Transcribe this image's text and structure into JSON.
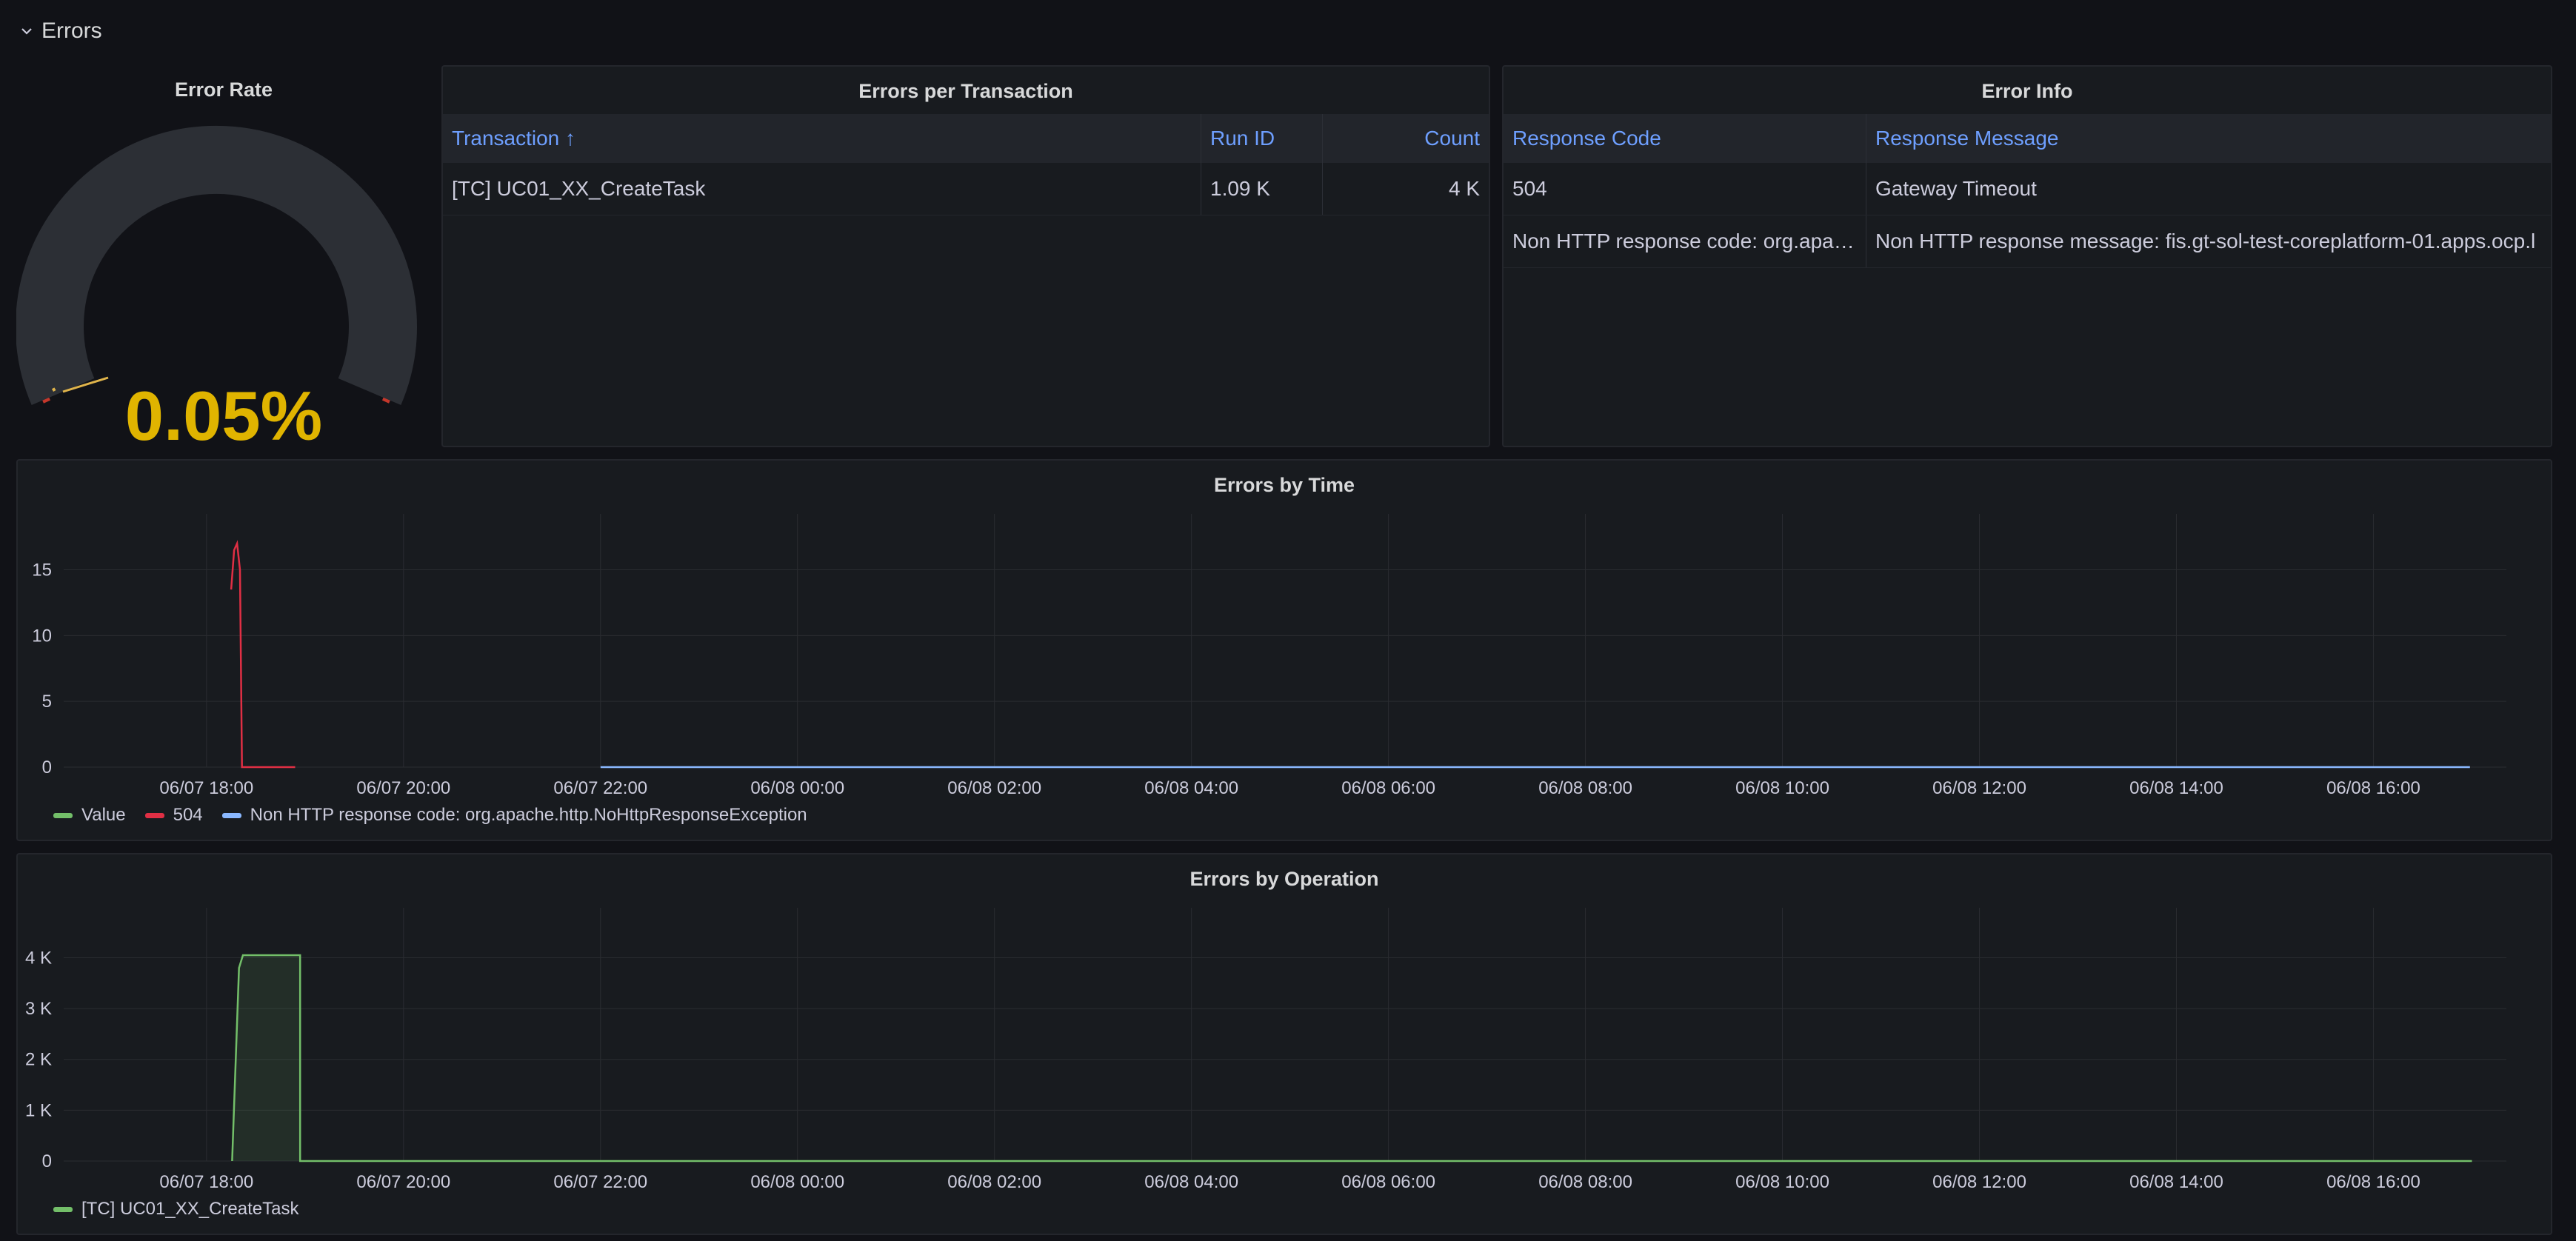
{
  "row": {
    "title": "Errors"
  },
  "gauge": {
    "title": "Error Rate",
    "value": "0.05%",
    "fraction": 0.0005,
    "color_value": "#e0b44b",
    "color_threshold": "#c4372b"
  },
  "txn_table": {
    "title": "Errors per Transaction",
    "columns": [
      "Transaction ↑",
      "Run ID",
      "Count"
    ],
    "rows": [
      [
        "[TC] UC01_XX_CreateTask",
        "1.09 K",
        "4 K"
      ]
    ]
  },
  "info_table": {
    "title": "Error Info",
    "columns": [
      "Response Code",
      "Response Message"
    ],
    "rows": [
      [
        "504",
        "Gateway Timeout"
      ],
      [
        "Non HTTP response code: org.apache.http.NoHttpResponseException",
        "Non HTTP response message: fis.gt-sol-test-coreplatform-01.apps.ocp.l"
      ]
    ]
  },
  "chart_data": [
    {
      "type": "line",
      "title": "Errors by Time",
      "x_ticks": [
        "06/07 18:00",
        "06/07 20:00",
        "06/07 22:00",
        "06/08 00:00",
        "06/08 02:00",
        "06/08 04:00",
        "06/08 06:00",
        "06/08 08:00",
        "06/08 10:00",
        "06/08 12:00",
        "06/08 14:00",
        "06/08 16:00"
      ],
      "y_ticks": [
        "0",
        "5",
        "10",
        "15"
      ],
      "ylim": [
        0,
        17
      ],
      "xlim_hours": [
        16.55,
        41.35
      ],
      "series": [
        {
          "name": "Value",
          "color": "#73bf69",
          "points": []
        },
        {
          "name": "504",
          "color": "#e02f44",
          "points": [
            [
              18.25,
              13.5
            ],
            [
              18.28,
              16.5
            ],
            [
              18.31,
              17
            ],
            [
              18.34,
              15
            ],
            [
              18.36,
              0
            ],
            [
              18.9,
              0
            ]
          ]
        },
        {
          "name": "Non HTTP response code: org.apache.http.NoHttpResponseException",
          "color": "#8ab8ff",
          "points": [
            [
              22.0,
              0
            ],
            [
              40.98,
              0
            ]
          ]
        }
      ]
    },
    {
      "type": "area",
      "title": "Errors by Operation",
      "x_ticks": [
        "06/07 18:00",
        "06/07 20:00",
        "06/07 22:00",
        "06/08 00:00",
        "06/08 02:00",
        "06/08 04:00",
        "06/08 06:00",
        "06/08 08:00",
        "06/08 10:00",
        "06/08 12:00",
        "06/08 14:00",
        "06/08 16:00"
      ],
      "y_ticks": [
        "0",
        "1 K",
        "2 K",
        "3 K",
        "4 K"
      ],
      "ylim": [
        0,
        4400
      ],
      "xlim_hours": [
        16.55,
        41.35
      ],
      "series": [
        {
          "name": "[TC] UC01_XX_CreateTask",
          "color": "#73bf69",
          "points": [
            [
              18.26,
              0
            ],
            [
              18.33,
              3800
            ],
            [
              18.37,
              4050
            ],
            [
              18.95,
              4050
            ],
            [
              18.95,
              0
            ],
            [
              22.0,
              0
            ],
            [
              41.0,
              0
            ]
          ]
        }
      ]
    }
  ]
}
